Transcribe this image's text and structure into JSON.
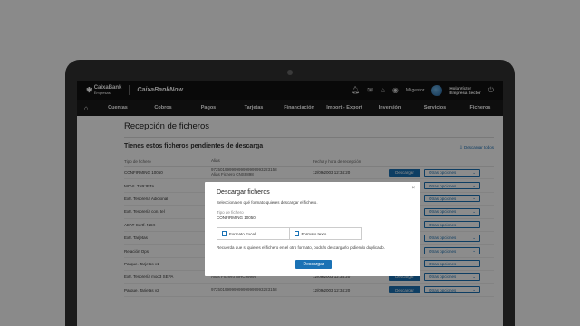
{
  "header": {
    "brand": "CaixaBank",
    "brand_sub": "Empresas",
    "app_name": "CaixaBankNow",
    "my_manager": "Mi gestor",
    "user_name": "Hola Víctor",
    "user_company": "Empresa Sector"
  },
  "nav": {
    "items": [
      "Cuentas",
      "Cobros",
      "Pagos",
      "Tarjetas",
      "Financiación",
      "Import - Export",
      "Inversión",
      "Servicios",
      "Ficheros"
    ]
  },
  "page": {
    "title": "Recepción de ficheros",
    "subtitle": "Tienes estos ficheros pendientes de descarga",
    "download_all": "Descargar todos"
  },
  "table": {
    "headers": [
      "Tipo de fichero",
      "Alias",
      "Fecha y hora de recepción"
    ],
    "download_label": "Descargar",
    "more_label": "Otras opciones",
    "rows": [
      {
        "type": "CONFIRMING 10050",
        "alias1": "97250199999999999999993223158",
        "alias2": "Alias Fichero CNS9898",
        "date": "12/09/2003 12:34:20"
      },
      {
        "type": "MOVI. TARJETA",
        "alias1": "97250199999999999999993223158",
        "alias2": "",
        "date": "12/09/2003 12:34:20"
      },
      {
        "type": "Extr. Tesorería Adicional",
        "alias1": "",
        "alias2": "",
        "date": ""
      },
      {
        "type": "Extr. Tesorería con. tel",
        "alias1": "",
        "alias2": "",
        "date": ""
      },
      {
        "type": "AEAT-Certf. NCX",
        "alias1": "",
        "alias2": "",
        "date": ""
      },
      {
        "type": "Extr. Tarjetas",
        "alias1": "",
        "alias2": "",
        "date": ""
      },
      {
        "type": "Relación Ops",
        "alias1": "",
        "alias2": "",
        "date": ""
      },
      {
        "type": "Parque. Tarjetas v1",
        "alias1": "97250199999999999999993223158",
        "alias2": "",
        "date": "12/09/2003 12:34:20"
      },
      {
        "type": "Extr. Tesorería mod3 SEPA",
        "alias1": "Alias Fichero MHC99999",
        "alias2": "",
        "date": "12/09/2003 12:34:20"
      },
      {
        "type": "Parque. Tarjetas v2",
        "alias1": "97250199999999999999993223158",
        "alias2": "",
        "date": "12/09/2003 12:34:20"
      }
    ]
  },
  "modal": {
    "title": "Descargar ficheros",
    "text": "Selecciona en qué formato quieres descargar el fichero.",
    "label": "Tipo de fichero",
    "value": "CONFIRMING 10050",
    "format1": "Formato Excel",
    "format2": "Formato texto",
    "note": "Recuerda que si quieres el fichero en el otro formato, podrás descargarlo pidiendo duplicado.",
    "button": "Descargar",
    "close": "×"
  },
  "colors": {
    "primary": "#1a72b5",
    "topbar": "#111111"
  }
}
